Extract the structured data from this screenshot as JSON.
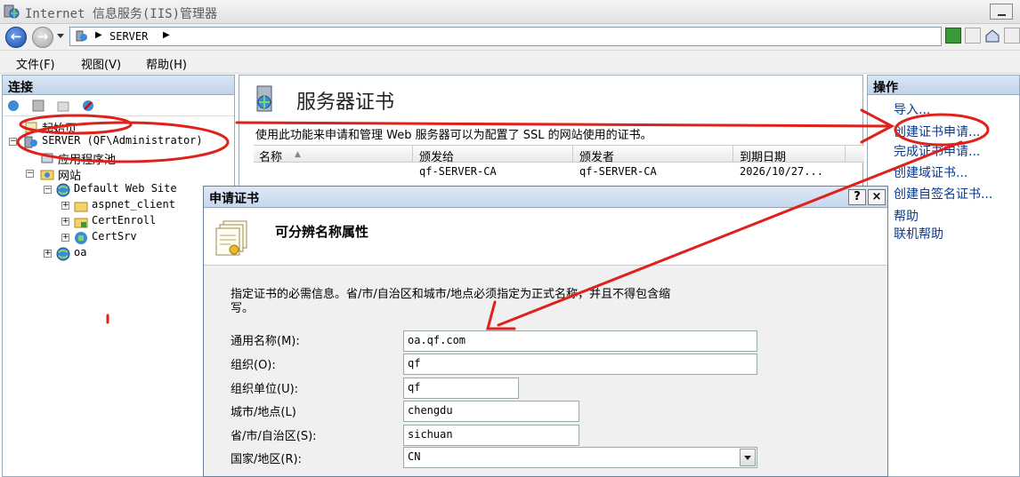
{
  "window": {
    "title": "Internet 信息服务(IIS)管理器"
  },
  "address_bar": {
    "crumb": "SERVER"
  },
  "menu": [
    "文件(F)",
    "视图(V)",
    "帮助(H)"
  ],
  "connections": {
    "header": "连接",
    "tree": [
      {
        "label": "起始页"
      },
      {
        "label": "SERVER (QF\\Administrator)"
      },
      {
        "label": "应用程序池"
      },
      {
        "label": "网站"
      },
      {
        "label": "Default Web Site"
      },
      {
        "label": "aspnet_client"
      },
      {
        "label": "CertEnroll"
      },
      {
        "label": "CertSrv"
      },
      {
        "label": "oa"
      }
    ]
  },
  "main": {
    "title": "服务器证书",
    "description": "使用此功能来申请和管理 Web 服务器可以为配置了 SSL 的网站使用的证书。",
    "columns": [
      "名称",
      "颁发给",
      "颁发者",
      "到期日期"
    ],
    "rows": [
      {
        "name": "",
        "issued_to": "qf-SERVER-CA",
        "issuer": "qf-SERVER-CA",
        "expiry": "2026/10/27..."
      }
    ]
  },
  "actions": {
    "header": "操作",
    "items": [
      "导入...",
      "创建证书申请...",
      "完成证书申请...",
      "创建域证书...",
      "创建自签名证书...",
      "帮助",
      "联机帮助"
    ]
  },
  "dialog": {
    "title": "申请证书",
    "help_btn": "?",
    "close_btn": "×",
    "banner_title": "可分辨名称属性",
    "instructions": "指定证书的必需信息。省/市/自治区和城市/地点必须指定为正式名称，并且不得包含缩写。",
    "fields": [
      {
        "label": "通用名称(M):",
        "value": "oa.qf.com"
      },
      {
        "label": "组织(O):",
        "value": "qf"
      },
      {
        "label": "组织单位(U):",
        "value": "qf"
      },
      {
        "label": "城市/地点(L)",
        "value": "chengdu"
      },
      {
        "label": "省/市/自治区(S):",
        "value": "sichuan"
      },
      {
        "label": "国家/地区(R):",
        "value": "CN"
      }
    ]
  },
  "colors": {
    "annotation": "#e0201b",
    "link": "#0b3a8c",
    "header_bg": "#c7d8ee"
  }
}
